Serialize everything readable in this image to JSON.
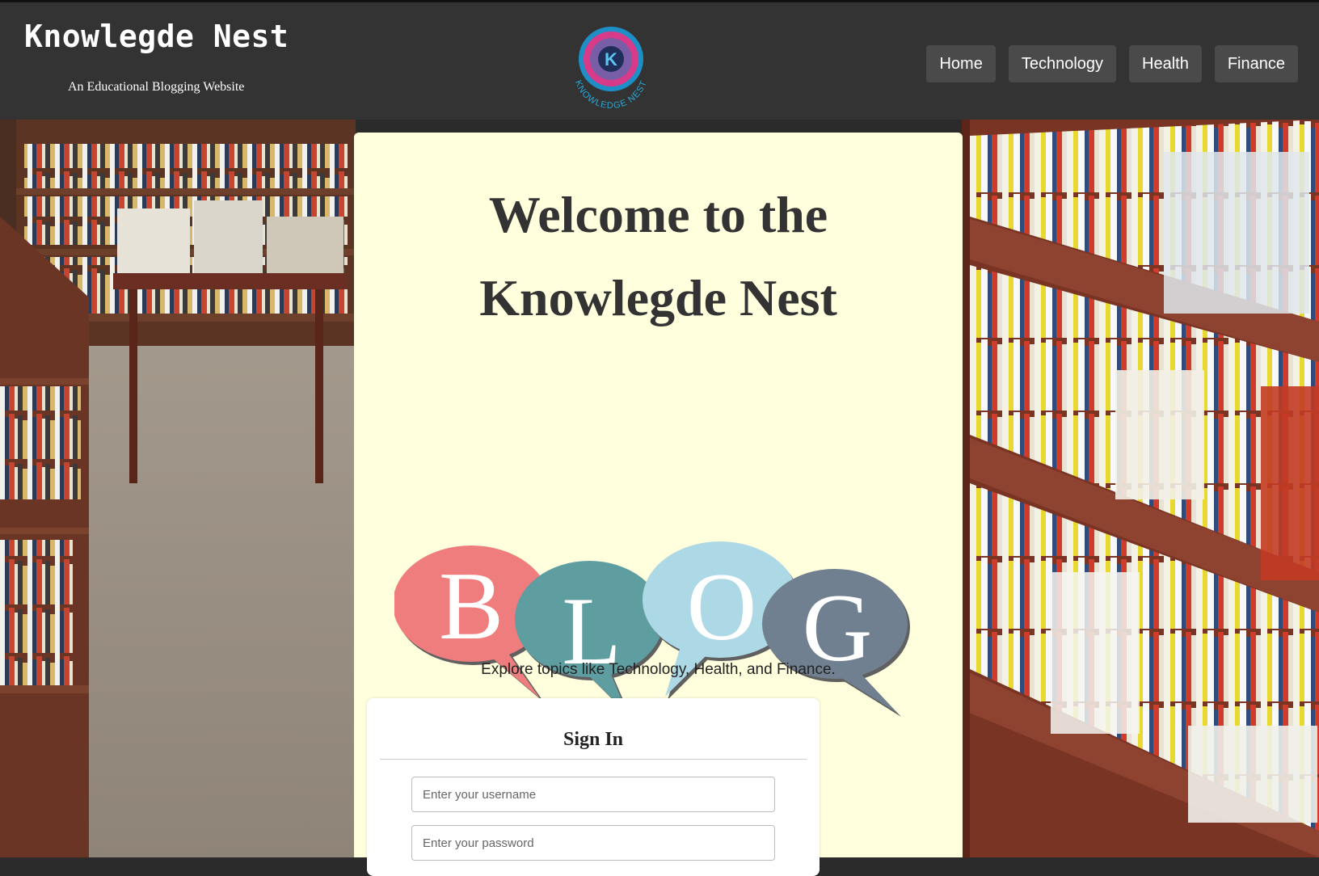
{
  "header": {
    "site_title": "Knowlegde Nest",
    "tagline": "An Educational Blogging Website",
    "logo": {
      "letter": "K",
      "ring_text": "KNOWLEDGE NEST"
    },
    "nav": [
      {
        "label": "Home"
      },
      {
        "label": "Technology"
      },
      {
        "label": "Health"
      },
      {
        "label": "Finance"
      }
    ]
  },
  "main": {
    "welcome_line1": "Welcome to the",
    "welcome_line2": "Knowlegde Nest",
    "blog_letters": [
      "B",
      "L",
      "O",
      "G"
    ],
    "blog_colors": [
      "#ef7d7d",
      "#5e9ea0",
      "#add8e6",
      "#708090"
    ],
    "explore_text": "Explore topics like Technology, Health, and Finance."
  },
  "signin": {
    "title": "Sign In",
    "username_placeholder": "Enter your username",
    "password_placeholder": "Enter your password"
  }
}
